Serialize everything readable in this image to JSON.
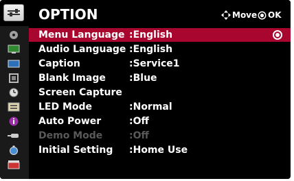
{
  "header": {
    "title": "OPTION",
    "move_hint": "Move",
    "ok_hint": "OK"
  },
  "sidebar": {
    "icons": [
      "disc-icon",
      "monitor-icon",
      "screen-icon",
      "square-icon",
      "clock-icon",
      "option-icon",
      "info-icon",
      "input-icon",
      "timer-icon",
      "clapper-icon"
    ],
    "active": "option-icon"
  },
  "menu": {
    "items": [
      {
        "label": "Menu Language",
        "value": ":English",
        "selected": true,
        "disabled": false
      },
      {
        "label": "Audio Language",
        "value": ":English",
        "selected": false,
        "disabled": false
      },
      {
        "label": "Caption",
        "value": ":Service1",
        "selected": false,
        "disabled": false
      },
      {
        "label": "Blank Image",
        "value": ":Blue",
        "selected": false,
        "disabled": false
      },
      {
        "label": "Screen Capture",
        "value": "",
        "selected": false,
        "disabled": false
      },
      {
        "label": "LED Mode",
        "value": ":Normal",
        "selected": false,
        "disabled": false
      },
      {
        "label": "Auto Power",
        "value": ":Off",
        "selected": false,
        "disabled": false
      },
      {
        "label": "Demo Mode",
        "value": ":Off",
        "selected": false,
        "disabled": true
      },
      {
        "label": "Initial Setting",
        "value": ":Home Use",
        "selected": false,
        "disabled": false
      }
    ]
  },
  "colors": {
    "background": "#000000",
    "selected_row": "#a8062e",
    "text": "#ffffff",
    "disabled_text": "#595959"
  }
}
